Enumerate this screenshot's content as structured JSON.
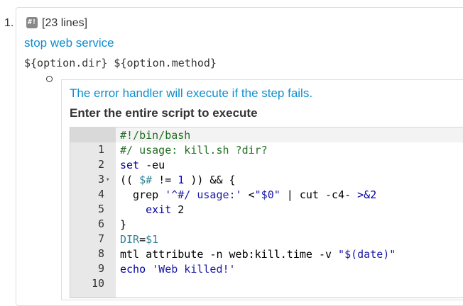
{
  "step": {
    "number": "1.",
    "badge_glyph": "#!",
    "line_count": "[23 lines]",
    "title": "stop web service",
    "args": "${option.dir} ${option.method}"
  },
  "error_handler": {
    "description": "The error handler will execute if the step fails.",
    "heading": "Enter the entire script to execute"
  },
  "editor": {
    "lines": [
      {
        "num": "1",
        "text": "#!/bin/bash"
      },
      {
        "num": "2",
        "text": "#/ usage: kill.sh ?dir?"
      },
      {
        "num": "3",
        "text": "set -eu"
      },
      {
        "num": "4",
        "text": "(( $# != 1 )) && {"
      },
      {
        "num": "5",
        "text": "  grep '^#/ usage:' <\"$0\" | cut -c4- >&2"
      },
      {
        "num": "6",
        "text": "    exit 2"
      },
      {
        "num": "7",
        "text": "}"
      },
      {
        "num": "8",
        "text": "DIR=$1"
      },
      {
        "num": "9",
        "text": "mtl attribute -n web:kill.time -v \"$(date)\""
      },
      {
        "num": "10",
        "text": "echo 'Web killed!'"
      }
    ],
    "fold_icon": "caret-down-icon"
  },
  "colors": {
    "link_blue": "#0e8ece",
    "comment_green": "#236e24",
    "gutter_gray": "#e8e8e8"
  }
}
